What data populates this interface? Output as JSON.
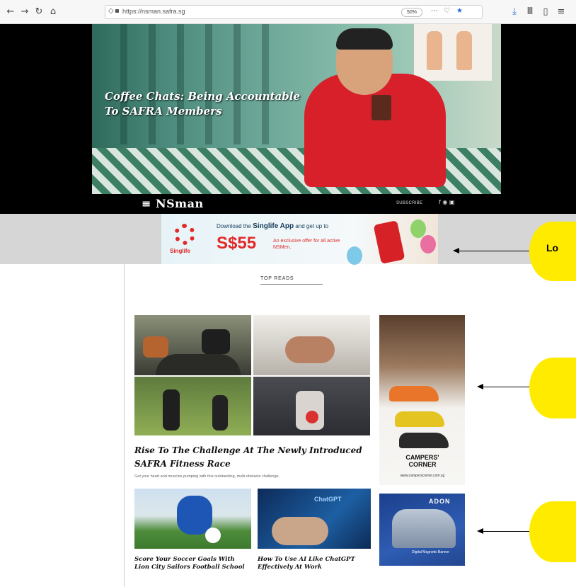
{
  "browser": {
    "url": "https://nsman.safra.sg",
    "zoom": "50%",
    "nav_icons": [
      "back-icon",
      "forward-icon",
      "reload-icon",
      "home-icon"
    ],
    "toolbar_icons": [
      "download-icon",
      "library-icon",
      "sidebar-icon",
      "menu-icon"
    ]
  },
  "hero": {
    "headline": "Coffee Chats: Being Accountable To SAFRA Members",
    "site_logo": "≡ NSman",
    "subscribe_label": "SUBSCRIBE"
  },
  "singlife_ad": {
    "brand": "Singlife",
    "line1_pre": "Download the ",
    "line1_bold": "Singlife App",
    "line1_post": " and get up to",
    "amount": "S$55",
    "sub": "An exclusive offer for all active NSMen."
  },
  "annotation": {
    "callout_text": "Lo"
  },
  "section": {
    "title": "TOP READS"
  },
  "featured": {
    "title": "Rise To The Challenge At The Newly Introduced SAFRA Fitness Race",
    "desc": "Get your heart and muscles pumping with this outstanding, multi-obstacle challenge."
  },
  "ads": {
    "campers_logo": "CAMPERS' CORNER",
    "campers_web": "www.camperscorner.com.sg",
    "adon_title": "ADON",
    "adon_text": "Digital Magnetic Banner"
  },
  "articles": [
    {
      "title": "Score Your Soccer Goals With Lion City Sailors Football School"
    },
    {
      "title": "How To Use AI Like ChatGPT Effectively At Work"
    }
  ],
  "colors": {
    "callout": "#ffeb00",
    "brand_red": "#e32a2a"
  }
}
